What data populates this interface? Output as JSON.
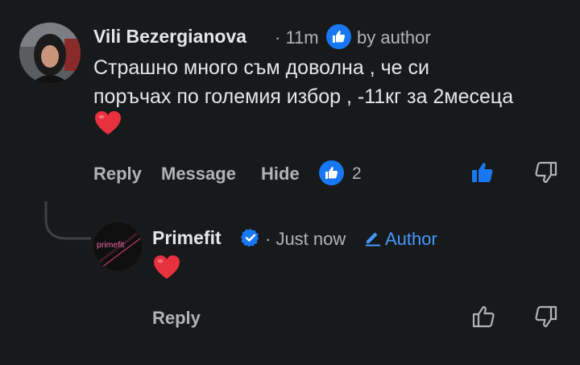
{
  "comment": {
    "author": "Vili Bezergianova",
    "time": "· 11m",
    "badge_text": "by author",
    "text_line1": "Страшно много съм доволна , че си",
    "text_line2": "поръчах по големия избор , -11кг за 2месеца",
    "emoji": "❤️",
    "actions": {
      "reply": "Reply",
      "message": "Message",
      "hide": "Hide"
    },
    "like_count": "2"
  },
  "reply": {
    "author": "Primefit",
    "time": "· Just now",
    "author_label": "Author",
    "avatar_text": "primefit",
    "emoji": "❤️",
    "actions": {
      "reply": "Reply"
    }
  },
  "colors": {
    "background": "#18191a",
    "accent": "#1877f2",
    "link": "#4599ff",
    "secondary": "#b0b3b8",
    "heart": "#e8313f"
  }
}
